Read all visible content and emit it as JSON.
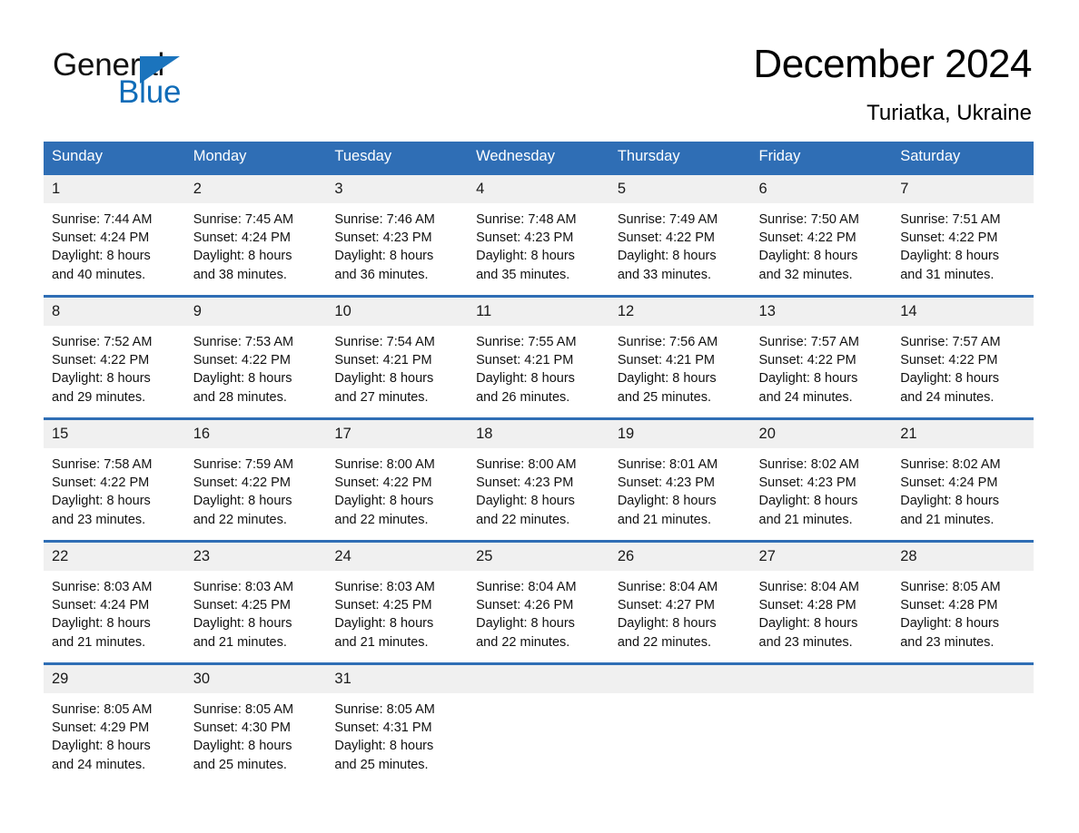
{
  "brand": {
    "name_part1": "General",
    "name_part2": "Blue",
    "triangle_color": "#1b74bd",
    "blue_color": "#0f6cb8"
  },
  "header": {
    "month_title": "December 2024",
    "location": "Turiatka, Ukraine"
  },
  "theme": {
    "header_blue": "#2f6eb5",
    "daynum_band": "#f0f0f0",
    "page_background": "#ffffff"
  },
  "calendar": {
    "weekday_headers": [
      "Sunday",
      "Monday",
      "Tuesday",
      "Wednesday",
      "Thursday",
      "Friday",
      "Saturday"
    ],
    "weeks": [
      [
        {
          "day": "1",
          "sunrise": "Sunrise: 7:44 AM",
          "sunset": "Sunset: 4:24 PM",
          "daylight_line1": "Daylight: 8 hours",
          "daylight_line2": "and 40 minutes."
        },
        {
          "day": "2",
          "sunrise": "Sunrise: 7:45 AM",
          "sunset": "Sunset: 4:24 PM",
          "daylight_line1": "Daylight: 8 hours",
          "daylight_line2": "and 38 minutes."
        },
        {
          "day": "3",
          "sunrise": "Sunrise: 7:46 AM",
          "sunset": "Sunset: 4:23 PM",
          "daylight_line1": "Daylight: 8 hours",
          "daylight_line2": "and 36 minutes."
        },
        {
          "day": "4",
          "sunrise": "Sunrise: 7:48 AM",
          "sunset": "Sunset: 4:23 PM",
          "daylight_line1": "Daylight: 8 hours",
          "daylight_line2": "and 35 minutes."
        },
        {
          "day": "5",
          "sunrise": "Sunrise: 7:49 AM",
          "sunset": "Sunset: 4:22 PM",
          "daylight_line1": "Daylight: 8 hours",
          "daylight_line2": "and 33 minutes."
        },
        {
          "day": "6",
          "sunrise": "Sunrise: 7:50 AM",
          "sunset": "Sunset: 4:22 PM",
          "daylight_line1": "Daylight: 8 hours",
          "daylight_line2": "and 32 minutes."
        },
        {
          "day": "7",
          "sunrise": "Sunrise: 7:51 AM",
          "sunset": "Sunset: 4:22 PM",
          "daylight_line1": "Daylight: 8 hours",
          "daylight_line2": "and 31 minutes."
        }
      ],
      [
        {
          "day": "8",
          "sunrise": "Sunrise: 7:52 AM",
          "sunset": "Sunset: 4:22 PM",
          "daylight_line1": "Daylight: 8 hours",
          "daylight_line2": "and 29 minutes."
        },
        {
          "day": "9",
          "sunrise": "Sunrise: 7:53 AM",
          "sunset": "Sunset: 4:22 PM",
          "daylight_line1": "Daylight: 8 hours",
          "daylight_line2": "and 28 minutes."
        },
        {
          "day": "10",
          "sunrise": "Sunrise: 7:54 AM",
          "sunset": "Sunset: 4:21 PM",
          "daylight_line1": "Daylight: 8 hours",
          "daylight_line2": "and 27 minutes."
        },
        {
          "day": "11",
          "sunrise": "Sunrise: 7:55 AM",
          "sunset": "Sunset: 4:21 PM",
          "daylight_line1": "Daylight: 8 hours",
          "daylight_line2": "and 26 minutes."
        },
        {
          "day": "12",
          "sunrise": "Sunrise: 7:56 AM",
          "sunset": "Sunset: 4:21 PM",
          "daylight_line1": "Daylight: 8 hours",
          "daylight_line2": "and 25 minutes."
        },
        {
          "day": "13",
          "sunrise": "Sunrise: 7:57 AM",
          "sunset": "Sunset: 4:22 PM",
          "daylight_line1": "Daylight: 8 hours",
          "daylight_line2": "and 24 minutes."
        },
        {
          "day": "14",
          "sunrise": "Sunrise: 7:57 AM",
          "sunset": "Sunset: 4:22 PM",
          "daylight_line1": "Daylight: 8 hours",
          "daylight_line2": "and 24 minutes."
        }
      ],
      [
        {
          "day": "15",
          "sunrise": "Sunrise: 7:58 AM",
          "sunset": "Sunset: 4:22 PM",
          "daylight_line1": "Daylight: 8 hours",
          "daylight_line2": "and 23 minutes."
        },
        {
          "day": "16",
          "sunrise": "Sunrise: 7:59 AM",
          "sunset": "Sunset: 4:22 PM",
          "daylight_line1": "Daylight: 8 hours",
          "daylight_line2": "and 22 minutes."
        },
        {
          "day": "17",
          "sunrise": "Sunrise: 8:00 AM",
          "sunset": "Sunset: 4:22 PM",
          "daylight_line1": "Daylight: 8 hours",
          "daylight_line2": "and 22 minutes."
        },
        {
          "day": "18",
          "sunrise": "Sunrise: 8:00 AM",
          "sunset": "Sunset: 4:23 PM",
          "daylight_line1": "Daylight: 8 hours",
          "daylight_line2": "and 22 minutes."
        },
        {
          "day": "19",
          "sunrise": "Sunrise: 8:01 AM",
          "sunset": "Sunset: 4:23 PM",
          "daylight_line1": "Daylight: 8 hours",
          "daylight_line2": "and 21 minutes."
        },
        {
          "day": "20",
          "sunrise": "Sunrise: 8:02 AM",
          "sunset": "Sunset: 4:23 PM",
          "daylight_line1": "Daylight: 8 hours",
          "daylight_line2": "and 21 minutes."
        },
        {
          "day": "21",
          "sunrise": "Sunrise: 8:02 AM",
          "sunset": "Sunset: 4:24 PM",
          "daylight_line1": "Daylight: 8 hours",
          "daylight_line2": "and 21 minutes."
        }
      ],
      [
        {
          "day": "22",
          "sunrise": "Sunrise: 8:03 AM",
          "sunset": "Sunset: 4:24 PM",
          "daylight_line1": "Daylight: 8 hours",
          "daylight_line2": "and 21 minutes."
        },
        {
          "day": "23",
          "sunrise": "Sunrise: 8:03 AM",
          "sunset": "Sunset: 4:25 PM",
          "daylight_line1": "Daylight: 8 hours",
          "daylight_line2": "and 21 minutes."
        },
        {
          "day": "24",
          "sunrise": "Sunrise: 8:03 AM",
          "sunset": "Sunset: 4:25 PM",
          "daylight_line1": "Daylight: 8 hours",
          "daylight_line2": "and 21 minutes."
        },
        {
          "day": "25",
          "sunrise": "Sunrise: 8:04 AM",
          "sunset": "Sunset: 4:26 PM",
          "daylight_line1": "Daylight: 8 hours",
          "daylight_line2": "and 22 minutes."
        },
        {
          "day": "26",
          "sunrise": "Sunrise: 8:04 AM",
          "sunset": "Sunset: 4:27 PM",
          "daylight_line1": "Daylight: 8 hours",
          "daylight_line2": "and 22 minutes."
        },
        {
          "day": "27",
          "sunrise": "Sunrise: 8:04 AM",
          "sunset": "Sunset: 4:28 PM",
          "daylight_line1": "Daylight: 8 hours",
          "daylight_line2": "and 23 minutes."
        },
        {
          "day": "28",
          "sunrise": "Sunrise: 8:05 AM",
          "sunset": "Sunset: 4:28 PM",
          "daylight_line1": "Daylight: 8 hours",
          "daylight_line2": "and 23 minutes."
        }
      ],
      [
        {
          "day": "29",
          "sunrise": "Sunrise: 8:05 AM",
          "sunset": "Sunset: 4:29 PM",
          "daylight_line1": "Daylight: 8 hours",
          "daylight_line2": "and 24 minutes."
        },
        {
          "day": "30",
          "sunrise": "Sunrise: 8:05 AM",
          "sunset": "Sunset: 4:30 PM",
          "daylight_line1": "Daylight: 8 hours",
          "daylight_line2": "and 25 minutes."
        },
        {
          "day": "31",
          "sunrise": "Sunrise: 8:05 AM",
          "sunset": "Sunset: 4:31 PM",
          "daylight_line1": "Daylight: 8 hours",
          "daylight_line2": "and 25 minutes."
        },
        {
          "day": "",
          "sunrise": "",
          "sunset": "",
          "daylight_line1": "",
          "daylight_line2": ""
        },
        {
          "day": "",
          "sunrise": "",
          "sunset": "",
          "daylight_line1": "",
          "daylight_line2": ""
        },
        {
          "day": "",
          "sunrise": "",
          "sunset": "",
          "daylight_line1": "",
          "daylight_line2": ""
        },
        {
          "day": "",
          "sunrise": "",
          "sunset": "",
          "daylight_line1": "",
          "daylight_line2": ""
        }
      ]
    ]
  }
}
